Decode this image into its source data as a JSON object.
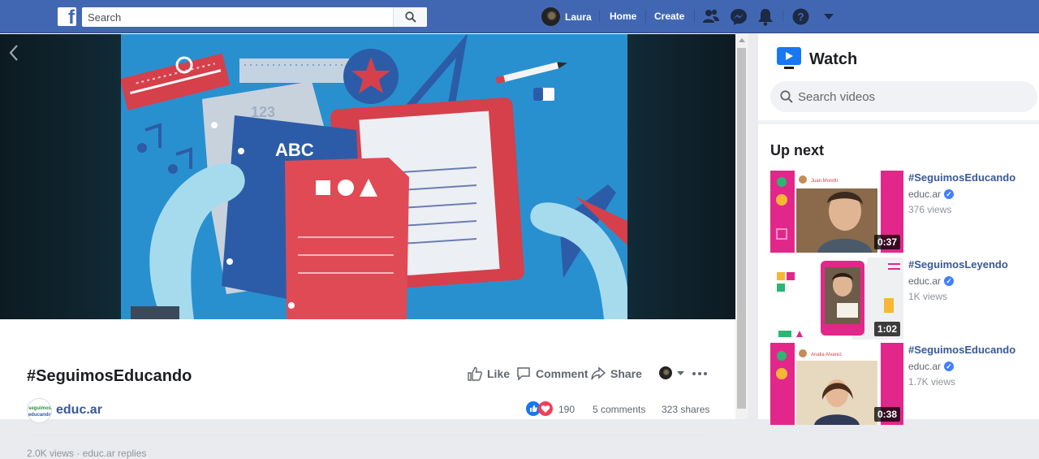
{
  "topbar": {
    "search_placeholder": "Search",
    "user_name": "Laura",
    "home_label": "Home",
    "create_label": "Create",
    "brand_color": "#4267b2"
  },
  "video": {
    "title": "#SeguimosEducando",
    "channel": "educ.ar",
    "like_label": "Like",
    "comment_label": "Comment",
    "share_label": "Share",
    "reaction_count": "190",
    "comments": "5 comments",
    "shares": "323 shares",
    "cut_off_text": "2.0K views · educ.ar replies"
  },
  "sidebar": {
    "title": "Watch",
    "search_placeholder": "Search videos",
    "up_next": "Up next",
    "items": [
      {
        "title": "#SeguimosEducando",
        "channel": "educ.ar",
        "views": "376 views",
        "duration": "0:37",
        "thumb_caption": "Juan Moretti"
      },
      {
        "title": "#SeguimosLeyendo",
        "channel": "educ.ar",
        "views": "1K views",
        "duration": "1:02"
      },
      {
        "title": "#SeguimosEducando",
        "channel": "educ.ar",
        "views": "1.7K views",
        "duration": "0:38",
        "thumb_caption": "Analia Alvarez"
      }
    ]
  },
  "icons": {
    "search": "search-icon",
    "friends": "friends-icon",
    "messenger": "messenger-icon",
    "notifications": "bell-icon",
    "help": "help-icon",
    "menu": "caret-down-icon",
    "watch": "watch-tv-icon"
  }
}
